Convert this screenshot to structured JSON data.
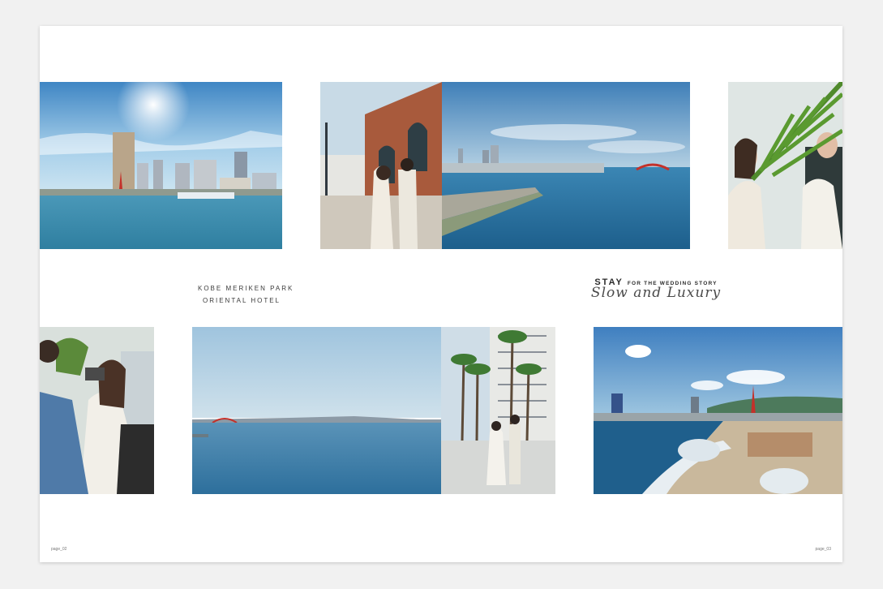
{
  "left_page": {
    "location_line1": "KOBE MERIKEN PARK",
    "location_line2": "ORIENTAL HOTEL",
    "page_label": "page_02"
  },
  "right_page": {
    "title_word": "STAY",
    "title_sub": "FOR THE WEDDING STORY",
    "script_line": "Slow and Luxury",
    "page_label": "page_03"
  }
}
